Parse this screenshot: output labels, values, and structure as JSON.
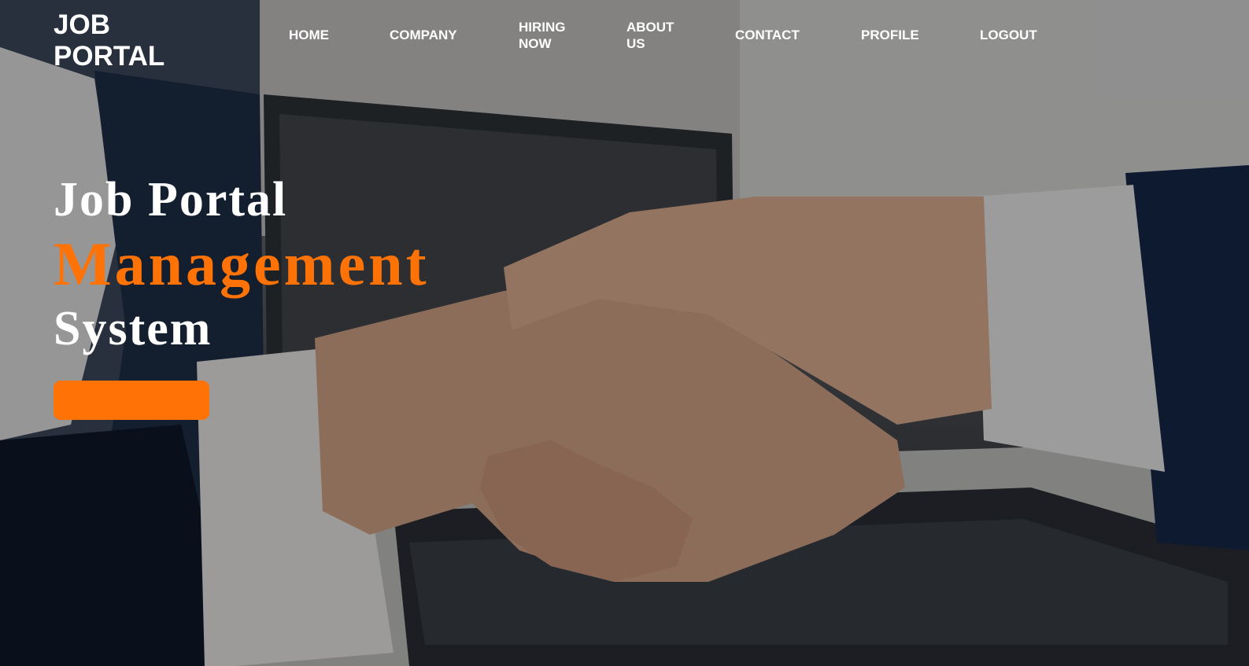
{
  "brand": {
    "logo": "JOB PORTAL",
    "accent_color": "#ff7206"
  },
  "nav": {
    "items": [
      {
        "label": "HOME"
      },
      {
        "label": "COMPANY"
      },
      {
        "label": "HIRING NOW"
      },
      {
        "label": "ABOUT US"
      },
      {
        "label": "CONTACT"
      },
      {
        "label": "PROFILE"
      },
      {
        "label": "LOGOUT"
      }
    ]
  },
  "hero": {
    "line1": "Job Portal",
    "line2": "Management",
    "line3": "System",
    "cta_label": "",
    "background_image": "handshake-photo"
  }
}
